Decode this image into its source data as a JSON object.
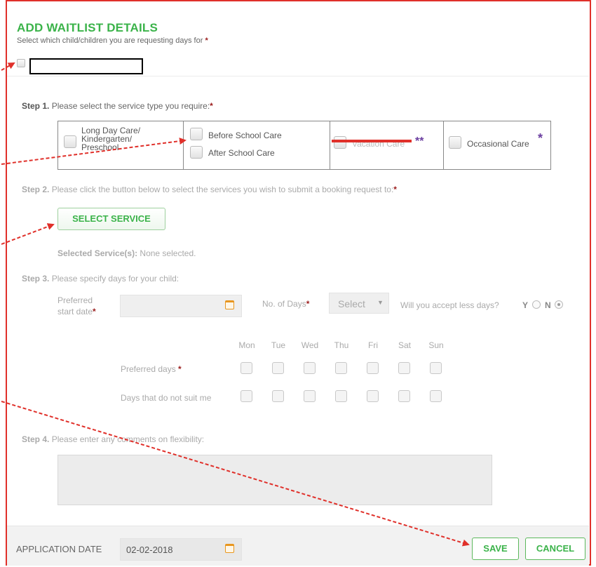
{
  "header": {
    "title": "ADD WAITLIST DETAILS",
    "subtitle": "Select which child/children you are requesting days for",
    "required_mark": "*"
  },
  "step1": {
    "label": "Step 1.",
    "text": "Please select the service type you require:",
    "options": {
      "long_day_care": "Long Day Care/\nKindergarten/\nPreschool",
      "before_school": "Before School Care",
      "after_school": "After School Care",
      "vacation": "Vacation Care",
      "vacation_mark": "**",
      "occasional": "Occasional Care",
      "occasional_mark": "*"
    }
  },
  "step2": {
    "label": "Step 2.",
    "text": "Please click the button below to select the services you wish to submit a booking request to:",
    "button": "SELECT SERVICE",
    "selected_label": "Selected Service(s):",
    "selected_value": "None selected."
  },
  "step3": {
    "label": "Step 3.",
    "text": "Please specify days for your child:",
    "preferred_start": "Preferred\nstart date",
    "no_of_days_label": "No. of Days",
    "no_of_days_value": "Select",
    "accept_less_label": "Will you accept less days?",
    "yes": "Y",
    "no": "N",
    "accept_less_selected": "N",
    "days": [
      "Mon",
      "Tue",
      "Wed",
      "Thu",
      "Fri",
      "Sat",
      "Sun"
    ],
    "preferred_days_label": "Preferred days",
    "unsuitable_days_label": "Days that do not suit me"
  },
  "step4": {
    "label": "Step 4.",
    "text": "Please enter any comments on flexibility:",
    "comments": ""
  },
  "footer": {
    "application_date_label": "APPLICATION DATE",
    "application_date_value": "02-02-2018",
    "save": "SAVE",
    "cancel": "CANCEL"
  },
  "colors": {
    "accent": "#3bb34a",
    "required": "#9b1c1c",
    "annotation": "#e0302a",
    "mark": "#6b3fa0"
  }
}
